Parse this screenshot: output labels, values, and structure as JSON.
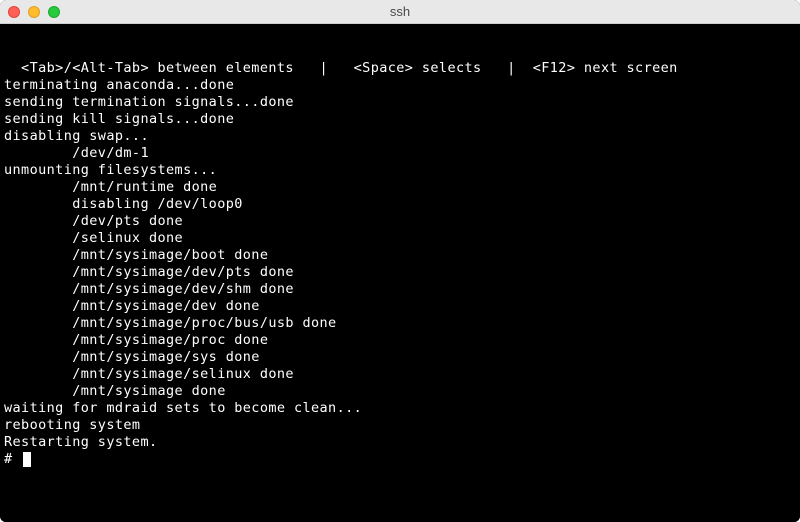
{
  "window": {
    "title": "ssh"
  },
  "terminal": {
    "lines": [
      "  <Tab>/<Alt-Tab> between elements   |   <Space> selects   |  <F12> next screen",
      "terminating anaconda...done",
      "sending termination signals...done",
      "sending kill signals...done",
      "disabling swap...",
      "        /dev/dm-1",
      "unmounting filesystems...",
      "        /mnt/runtime done",
      "        disabling /dev/loop0",
      "        /dev/pts done",
      "        /selinux done",
      "        /mnt/sysimage/boot done",
      "        /mnt/sysimage/dev/pts done",
      "        /mnt/sysimage/dev/shm done",
      "        /mnt/sysimage/dev done",
      "        /mnt/sysimage/proc/bus/usb done",
      "        /mnt/sysimage/proc done",
      "        /mnt/sysimage/sys done",
      "        /mnt/sysimage/selinux done",
      "        /mnt/sysimage done",
      "waiting for mdraid sets to become clean...",
      "rebooting system",
      "Restarting system."
    ],
    "prompt": "# "
  }
}
